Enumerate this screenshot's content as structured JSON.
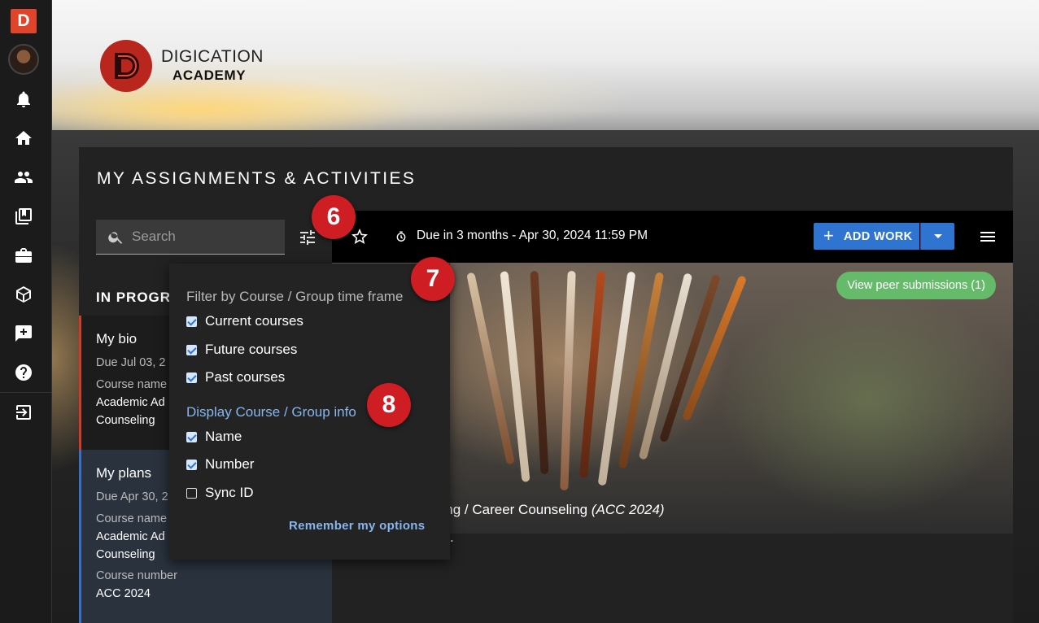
{
  "rail": {
    "logo_letter": "D",
    "icons": [
      "notifications-icon",
      "home-icon",
      "groups-icon",
      "portfolio-book-icon",
      "briefcase-icon",
      "cube-box-icon",
      "feedback-add-icon",
      "help-icon",
      "logout-icon"
    ]
  },
  "banner": {
    "brand_name": "DIGICATION",
    "brand_sub": "ACADEMY"
  },
  "page": {
    "title": "MY ASSIGNMENTS & ACTIVITIES",
    "search_placeholder": "Search"
  },
  "toolbar": {
    "due_text": "Due in 3 months - Apr 30, 2024 11:59 PM",
    "add_work_label": "ADD WORK"
  },
  "list": {
    "heading": "IN PROGR",
    "cards": [
      {
        "title": "My bio",
        "due": "Due Jul 03, 2",
        "course_label": "Course name",
        "course_value": "Academic Ad Counseling"
      },
      {
        "title": "My plans",
        "due": "Due Apr 30, 2",
        "course_label": "Course name",
        "course_value": "Academic Ad Counseling",
        "number_label": "Course number",
        "number_value": "ACC 2024"
      }
    ]
  },
  "hero": {
    "peer_button": "View peer submissions (1)",
    "caption_main": "sing / Career Counseling ",
    "caption_code": "(ACC 2024)",
    "desc_fragment": "ns."
  },
  "dropdown": {
    "timeframe_heading": "Filter by Course / Group time frame",
    "timeframe_options": [
      {
        "label": "Current courses",
        "checked": true
      },
      {
        "label": "Future courses",
        "checked": true
      },
      {
        "label": "Past courses",
        "checked": true
      }
    ],
    "info_heading": "Display Course / Group info",
    "info_options": [
      {
        "label": "Name",
        "checked": true
      },
      {
        "label": "Number",
        "checked": true
      },
      {
        "label": "Sync ID",
        "checked": false
      }
    ],
    "remember_label": "Remember my options"
  },
  "callouts": [
    "6",
    "7",
    "8"
  ],
  "colors": {
    "accent_blue": "#2f74d0",
    "brand_red": "#e0452b",
    "callout_red": "#cf1d24",
    "peer_green": "#66bb6a",
    "link_blue": "#86b6ee"
  }
}
